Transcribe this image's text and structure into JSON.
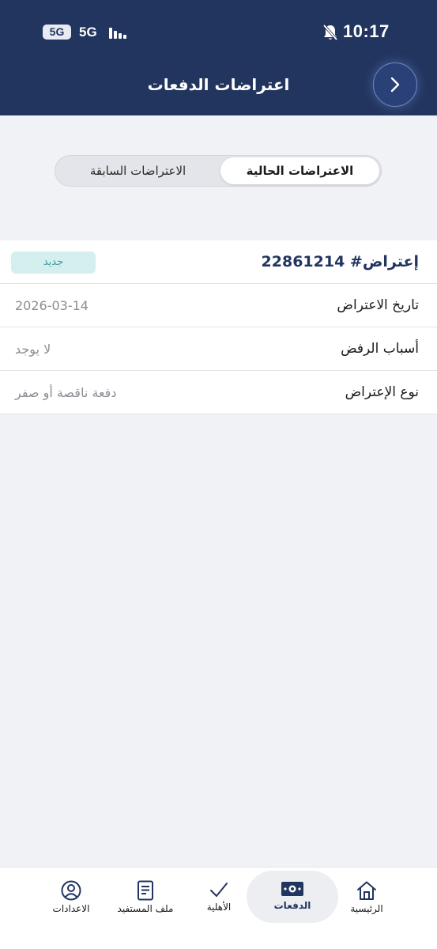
{
  "status_bar": {
    "time": "10:17",
    "sim_badge": "5G",
    "network": "5G"
  },
  "header": {
    "title": "اعتراضات الدفعات",
    "back_icon": "chevron-right-icon"
  },
  "tabs": {
    "current": "الاعتراضات الحالية",
    "previous": "الاعتراضات السابقة",
    "active": "current"
  },
  "objection": {
    "title": "إعتراض# 22861214",
    "status": "جديد",
    "rows": [
      {
        "label": "تاريخ الاعتراض",
        "value": "2026-03-14"
      },
      {
        "label": "أسباب الرفض",
        "value": "لا يوجد"
      },
      {
        "label": "نوع الإعتراض",
        "value": "دفعة ناقصة أو صفر"
      }
    ]
  },
  "bottom_nav": {
    "items": [
      {
        "label": "الرئيسية",
        "icon": "home-icon"
      },
      {
        "label": "الدفعات",
        "icon": "banknote-icon",
        "active": true
      },
      {
        "label": "الأهلية",
        "icon": "checkmark-icon"
      },
      {
        "label": "ملف المستفيد",
        "icon": "document-icon"
      },
      {
        "label": "الاعدادات",
        "icon": "user-circle-icon"
      }
    ]
  },
  "colors": {
    "header_bg": "#22355f",
    "page_bg": "#f1f2f6",
    "badge_bg": "#d5eeee",
    "badge_text": "#3f9fa6",
    "accent": "#22355f"
  }
}
